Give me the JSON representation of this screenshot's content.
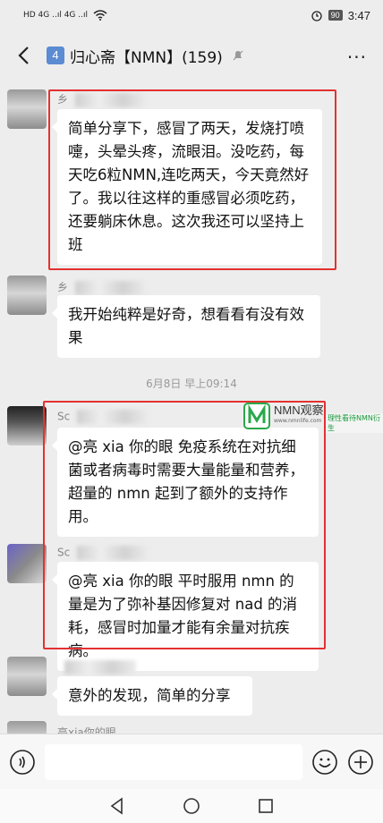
{
  "status_bar": {
    "signal": "HD 4G ..ıl 4G ..ıl",
    "battery": "90",
    "time": "3:47"
  },
  "header": {
    "badge": "4",
    "title": "归心斋【NMN】(159)",
    "more": "···"
  },
  "messages": [
    {
      "sender": "乡",
      "text": "简单分享下，感冒了两天，发烧打喷嚏，头晕头疼，流眼泪。没吃药，每天吃6粒NMN,连吃两天，今天竟然好了。我以往这样的重感冒必须吃药，还要躺床休息。这次我还可以坚持上班"
    },
    {
      "sender": "乡",
      "text": "我开始纯粹是好奇，想看看有没有效果"
    },
    {
      "sender": "Sc",
      "text": "@亮 xia 你的眼  免疫系统在对抗细菌或者病毒时需要大量能量和营养，超量的 nmn 起到了额外的支持作用。"
    },
    {
      "sender": "Sc",
      "text": "@亮 xia 你的眼  平时服用 nmn 的量是为了弥补基因修复对 nad 的消耗，感冒时加量才能有余量对抗疾病。"
    },
    {
      "sender": "",
      "text": "意外的发现，简单的分享"
    },
    {
      "sender": "亮xia你的眼",
      "text": ""
    }
  ],
  "timestamp": "6月8日 早上09:14",
  "watermark": {
    "title": "NMN观察",
    "url": "www.nmnlife.com",
    "side": "理性看待NMN衍生"
  },
  "input": {
    "placeholder": ""
  },
  "colors": {
    "highlight": "#e33131",
    "badge": "#5b8bd3",
    "background": "#ededed"
  }
}
